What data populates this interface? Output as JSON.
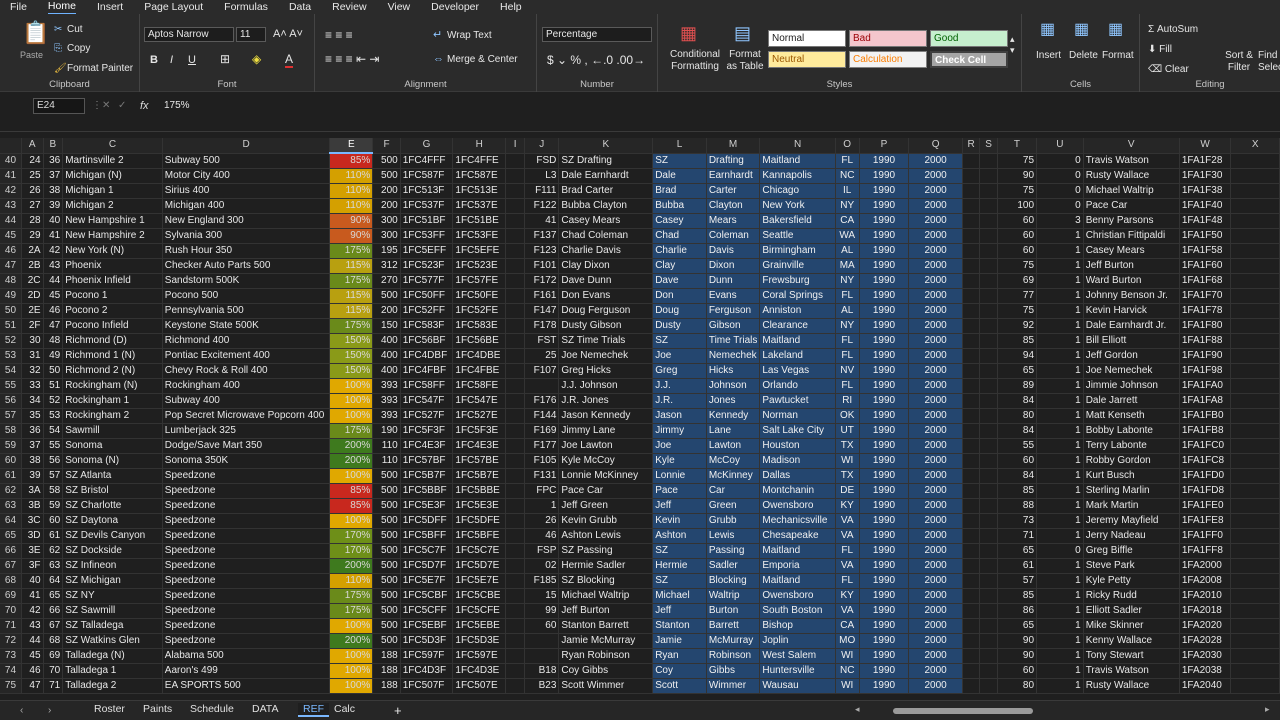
{
  "menu": [
    "File",
    "Home",
    "Insert",
    "Page Layout",
    "Formulas",
    "Data",
    "Review",
    "View",
    "Developer",
    "Help"
  ],
  "ribbon": {
    "clipboard": {
      "paste": "Paste",
      "cut": "Cut",
      "copy": "Copy",
      "painter": "Format Painter",
      "label": "Clipboard"
    },
    "font": {
      "name": "Aptos Narrow",
      "size": "11",
      "label": "Font"
    },
    "alignment": {
      "wrap": "Wrap Text",
      "merge": "Merge & Center",
      "label": "Alignment"
    },
    "number": {
      "format": "Percentage",
      "label": "Number"
    },
    "styles": {
      "cond": "Conditional Formatting",
      "table": "Format as Table",
      "normal": "Normal",
      "bad": "Bad",
      "good": "Good",
      "neutral": "Neutral",
      "calc": "Calculation",
      "check": "Check Cell",
      "label": "Styles"
    },
    "cells": {
      "insert": "Insert",
      "delete": "Delete",
      "format": "Format",
      "label": "Cells"
    },
    "editing": {
      "autosum": "AutoSum",
      "fill": "Fill",
      "clear": "Clear",
      "sort": "Sort & Filter",
      "find": "Find & Select",
      "label": "Editing"
    }
  },
  "formula": {
    "cell": "E24",
    "fx": "fx",
    "value": "175%"
  },
  "columns": [
    "A",
    "B",
    "C",
    "D",
    "E",
    "F",
    "G",
    "H",
    "I",
    "J",
    "K",
    "L",
    "M",
    "N",
    "O",
    "P",
    "Q",
    "R",
    "S",
    "T",
    "U",
    "V",
    "W",
    "X"
  ],
  "rows": [
    [
      "40",
      "24",
      "36",
      "Martinsville 2",
      "Subway 500",
      "85%",
      "500",
      "1FC4FFF",
      "1FC4FFE",
      "",
      "FSD",
      "SZ Drafting",
      "SZ",
      "Drafting",
      "Maitland",
      "FL",
      "1990",
      "2000",
      "",
      "",
      "75",
      "0",
      "Travis Watson",
      "1FA1F28",
      ""
    ],
    [
      "41",
      "25",
      "37",
      "Michigan (N)",
      "Motor City 400",
      "110%",
      "500",
      "1FC587F",
      "1FC587E",
      "",
      "L3",
      "Dale Earnhardt",
      "Dale",
      "Earnhardt",
      "Kannapolis",
      "NC",
      "1990",
      "2000",
      "",
      "",
      "90",
      "0",
      "Rusty Wallace",
      "1FA1F30",
      ""
    ],
    [
      "42",
      "26",
      "38",
      "Michigan 1",
      "Sirius 400",
      "110%",
      "200",
      "1FC513F",
      "1FC513E",
      "",
      "F111",
      "Brad Carter",
      "Brad",
      "Carter",
      "Chicago",
      "IL",
      "1990",
      "2000",
      "",
      "",
      "75",
      "0",
      "Michael Waltrip",
      "1FA1F38",
      ""
    ],
    [
      "43",
      "27",
      "39",
      "Michigan 2",
      "Michigan 400",
      "110%",
      "200",
      "1FC537F",
      "1FC537E",
      "",
      "F122",
      "Bubba Clayton",
      "Bubba",
      "Clayton",
      "New York",
      "NY",
      "1990",
      "2000",
      "",
      "",
      "100",
      "0",
      "Pace Car",
      "1FA1F40",
      ""
    ],
    [
      "44",
      "28",
      "40",
      "New Hampshire 1",
      "New England 300",
      "90%",
      "300",
      "1FC51BF",
      "1FC51BE",
      "",
      "41",
      "Casey Mears",
      "Casey",
      "Mears",
      "Bakersfield",
      "CA",
      "1990",
      "2000",
      "",
      "",
      "60",
      "3",
      "Benny Parsons",
      "1FA1F48",
      ""
    ],
    [
      "45",
      "29",
      "41",
      "New Hampshire 2",
      "Sylvania 300",
      "90%",
      "300",
      "1FC53FF",
      "1FC53FE",
      "",
      "F137",
      "Chad Coleman",
      "Chad",
      "Coleman",
      "Seattle",
      "WA",
      "1990",
      "2000",
      "",
      "",
      "60",
      "1",
      "Christian Fittipaldi",
      "1FA1F50",
      ""
    ],
    [
      "46",
      "2A",
      "42",
      "New York (N)",
      "Rush Hour 350",
      "175%",
      "195",
      "1FC5EFF",
      "1FC5EFE",
      "",
      "F123",
      "Charlie Davis",
      "Charlie",
      "Davis",
      "Birmingham",
      "AL",
      "1990",
      "2000",
      "",
      "",
      "60",
      "1",
      "Casey Mears",
      "1FA1F58",
      ""
    ],
    [
      "47",
      "2B",
      "43",
      "Phoenix",
      "Checker Auto Parts 500",
      "115%",
      "312",
      "1FC523F",
      "1FC523E",
      "",
      "F101",
      "Clay Dixon",
      "Clay",
      "Dixon",
      "Grainville",
      "MA",
      "1990",
      "2000",
      "",
      "",
      "75",
      "1",
      "Jeff Burton",
      "1FA1F60",
      ""
    ],
    [
      "48",
      "2C",
      "44",
      "Phoenix Infield",
      "Sandstorm 500K",
      "175%",
      "270",
      "1FC577F",
      "1FC57FE",
      "",
      "F172",
      "Dave Dunn",
      "Dave",
      "Dunn",
      "Frewsburg",
      "NY",
      "1990",
      "2000",
      "",
      "",
      "69",
      "1",
      "Ward Burton",
      "1FA1F68",
      ""
    ],
    [
      "49",
      "2D",
      "45",
      "Pocono 1",
      "Pocono 500",
      "115%",
      "500",
      "1FC50FF",
      "1FC50FE",
      "",
      "F161",
      "Don Evans",
      "Don",
      "Evans",
      "Coral Springs",
      "FL",
      "1990",
      "2000",
      "",
      "",
      "77",
      "1",
      "Johnny Benson Jr.",
      "1FA1F70",
      ""
    ],
    [
      "50",
      "2E",
      "46",
      "Pocono 2",
      "Pennsylvania 500",
      "115%",
      "200",
      "1FC52FF",
      "1FC52FE",
      "",
      "F147",
      "Doug Ferguson",
      "Doug",
      "Ferguson",
      "Anniston",
      "AL",
      "1990",
      "2000",
      "",
      "",
      "75",
      "1",
      "Kevin Harvick",
      "1FA1F78",
      ""
    ],
    [
      "51",
      "2F",
      "47",
      "Pocono Infield",
      "Keystone State 500K",
      "175%",
      "150",
      "1FC583F",
      "1FC583E",
      "",
      "F178",
      "Dusty Gibson",
      "Dusty",
      "Gibson",
      "Clearance",
      "NY",
      "1990",
      "2000",
      "",
      "",
      "92",
      "1",
      "Dale Earnhardt Jr.",
      "1FA1F80",
      ""
    ],
    [
      "52",
      "30",
      "48",
      "Richmond (D)",
      "Richmond 400",
      "150%",
      "400",
      "1FC56BF",
      "1FC56BE",
      "",
      "FST",
      "SZ Time Trials",
      "SZ",
      "Time Trials",
      "Maitland",
      "FL",
      "1990",
      "2000",
      "",
      "",
      "85",
      "1",
      "Bill Elliott",
      "1FA1F88",
      ""
    ],
    [
      "53",
      "31",
      "49",
      "Richmond 1 (N)",
      "Pontiac Excitement 400",
      "150%",
      "400",
      "1FC4DBF",
      "1FC4DBE",
      "",
      "25",
      "Joe Nemechek",
      "Joe",
      "Nemechek",
      "Lakeland",
      "FL",
      "1990",
      "2000",
      "",
      "",
      "94",
      "1",
      "Jeff Gordon",
      "1FA1F90",
      ""
    ],
    [
      "54",
      "32",
      "50",
      "Richmond 2 (N)",
      "Chevy Rock & Roll 400",
      "150%",
      "400",
      "1FC4FBF",
      "1FC4FBE",
      "",
      "F107",
      "Greg Hicks",
      "Greg",
      "Hicks",
      "Las Vegas",
      "NV",
      "1990",
      "2000",
      "",
      "",
      "65",
      "1",
      "Joe Nemechek",
      "1FA1F98",
      ""
    ],
    [
      "55",
      "33",
      "51",
      "Rockingham (N)",
      "Rockingham 400",
      "100%",
      "393",
      "1FC58FF",
      "1FC58FE",
      "",
      "",
      "J.J. Johnson",
      "J.J.",
      "Johnson",
      "Orlando",
      "FL",
      "1990",
      "2000",
      "",
      "",
      "89",
      "1",
      "Jimmie Johnson",
      "1FA1FA0",
      ""
    ],
    [
      "56",
      "34",
      "52",
      "Rockingham 1",
      "Subway 400",
      "100%",
      "393",
      "1FC547F",
      "1FC547E",
      "",
      "F176",
      "J.R. Jones",
      "J.R.",
      "Jones",
      "Pawtucket",
      "RI",
      "1990",
      "2000",
      "",
      "",
      "84",
      "1",
      "Dale Jarrett",
      "1FA1FA8",
      ""
    ],
    [
      "57",
      "35",
      "53",
      "Rockingham 2",
      "Pop Secret Microwave Popcorn 400",
      "100%",
      "393",
      "1FC527F",
      "1FC527E",
      "",
      "F144",
      "Jason Kennedy",
      "Jason",
      "Kennedy",
      "Norman",
      "OK",
      "1990",
      "2000",
      "",
      "",
      "80",
      "1",
      "Matt Kenseth",
      "1FA1FB0",
      ""
    ],
    [
      "58",
      "36",
      "54",
      "Sawmill",
      "Lumberjack 325",
      "175%",
      "190",
      "1FC5F3F",
      "1FC5F3E",
      "",
      "F169",
      "Jimmy Lane",
      "Jimmy",
      "Lane",
      "Salt Lake City",
      "UT",
      "1990",
      "2000",
      "",
      "",
      "84",
      "1",
      "Bobby Labonte",
      "1FA1FB8",
      ""
    ],
    [
      "59",
      "37",
      "55",
      "Sonoma",
      "Dodge/Save Mart 350",
      "200%",
      "110",
      "1FC4E3F",
      "1FC4E3E",
      "",
      "F177",
      "Joe Lawton",
      "Joe",
      "Lawton",
      "Houston",
      "TX",
      "1990",
      "2000",
      "",
      "",
      "55",
      "1",
      "Terry Labonte",
      "1FA1FC0",
      ""
    ],
    [
      "60",
      "38",
      "56",
      "Sonoma (N)",
      "Sonoma 350K",
      "200%",
      "110",
      "1FC57BF",
      "1FC57BE",
      "",
      "F105",
      "Kyle McCoy",
      "Kyle",
      "McCoy",
      "Madison",
      "WI",
      "1990",
      "2000",
      "",
      "",
      "60",
      "1",
      "Robby Gordon",
      "1FA1FC8",
      ""
    ],
    [
      "61",
      "39",
      "57",
      "SZ Atlanta",
      "Speedzone",
      "100%",
      "500",
      "1FC5B7F",
      "1FC5B7E",
      "",
      "F131",
      "Lonnie McKinney",
      "Lonnie",
      "McKinney",
      "Dallas",
      "TX",
      "1990",
      "2000",
      "",
      "",
      "84",
      "1",
      "Kurt Busch",
      "1FA1FD0",
      ""
    ],
    [
      "62",
      "3A",
      "58",
      "SZ Bristol",
      "Speedzone",
      "85%",
      "500",
      "1FC5BBF",
      "1FC5BBE",
      "",
      "FPC",
      "Pace Car",
      "Pace",
      "Car",
      "Montchanin",
      "DE",
      "1990",
      "2000",
      "",
      "",
      "85",
      "1",
      "Sterling Marlin",
      "1FA1FD8",
      ""
    ],
    [
      "63",
      "3B",
      "59",
      "SZ Charlotte",
      "Speedzone",
      "85%",
      "500",
      "1FC5E3F",
      "1FC5E3E",
      "",
      "1",
      "Jeff Green",
      "Jeff",
      "Green",
      "Owensboro",
      "KY",
      "1990",
      "2000",
      "",
      "",
      "88",
      "1",
      "Mark Martin",
      "1FA1FE0",
      ""
    ],
    [
      "64",
      "3C",
      "60",
      "SZ Daytona",
      "Speedzone",
      "100%",
      "500",
      "1FC5DFF",
      "1FC5DFE",
      "",
      "26",
      "Kevin Grubb",
      "Kevin",
      "Grubb",
      "Mechanicsville",
      "VA",
      "1990",
      "2000",
      "",
      "",
      "73",
      "1",
      "Jeremy Mayfield",
      "1FA1FE8",
      ""
    ],
    [
      "65",
      "3D",
      "61",
      "SZ Devils Canyon",
      "Speedzone",
      "170%",
      "500",
      "1FC5BFF",
      "1FC5BFE",
      "",
      "46",
      "Ashton Lewis",
      "Ashton",
      "Lewis",
      "Chesapeake",
      "VA",
      "1990",
      "2000",
      "",
      "",
      "71",
      "1",
      "Jerry Nadeau",
      "1FA1FF0",
      ""
    ],
    [
      "66",
      "3E",
      "62",
      "SZ Dockside",
      "Speedzone",
      "170%",
      "500",
      "1FC5C7F",
      "1FC5C7E",
      "",
      "FSP",
      "SZ Passing",
      "SZ",
      "Passing",
      "Maitland",
      "FL",
      "1990",
      "2000",
      "",
      "",
      "65",
      "0",
      "Greg Biffle",
      "1FA1FF8",
      ""
    ],
    [
      "67",
      "3F",
      "63",
      "SZ Infineon",
      "Speedzone",
      "200%",
      "500",
      "1FC5D7F",
      "1FC5D7E",
      "",
      "02",
      "Hermie Sadler",
      "Hermie",
      "Sadler",
      "Emporia",
      "VA",
      "1990",
      "2000",
      "",
      "",
      "61",
      "1",
      "Steve Park",
      "1FA2000",
      ""
    ],
    [
      "68",
      "40",
      "64",
      "SZ Michigan",
      "Speedzone",
      "110%",
      "500",
      "1FC5E7F",
      "1FC5E7E",
      "",
      "F185",
      "SZ Blocking",
      "SZ",
      "Blocking",
      "Maitland",
      "FL",
      "1990",
      "2000",
      "",
      "",
      "57",
      "1",
      "Kyle Petty",
      "1FA2008",
      ""
    ],
    [
      "69",
      "41",
      "65",
      "SZ NY",
      "Speedzone",
      "175%",
      "500",
      "1FC5CBF",
      "1FC5CBE",
      "",
      "15",
      "Michael Waltrip",
      "Michael",
      "Waltrip",
      "Owensboro",
      "KY",
      "1990",
      "2000",
      "",
      "",
      "85",
      "1",
      "Ricky Rudd",
      "1FA2010",
      ""
    ],
    [
      "70",
      "42",
      "66",
      "SZ Sawmill",
      "Speedzone",
      "175%",
      "500",
      "1FC5CFF",
      "1FC5CFE",
      "",
      "99",
      "Jeff Burton",
      "Jeff",
      "Burton",
      "South Boston",
      "VA",
      "1990",
      "2000",
      "",
      "",
      "86",
      "1",
      "Elliott Sadler",
      "1FA2018",
      ""
    ],
    [
      "71",
      "43",
      "67",
      "SZ Talladega",
      "Speedzone",
      "100%",
      "500",
      "1FC5EBF",
      "1FC5EBE",
      "",
      "60",
      "Stanton Barrett",
      "Stanton",
      "Barrett",
      "Bishop",
      "CA",
      "1990",
      "2000",
      "",
      "",
      "65",
      "1",
      "Mike Skinner",
      "1FA2020",
      ""
    ],
    [
      "72",
      "44",
      "68",
      "SZ Watkins Glen",
      "Speedzone",
      "200%",
      "500",
      "1FC5D3F",
      "1FC5D3E",
      "",
      "",
      "Jamie McMurray",
      "Jamie",
      "McMurray",
      "Joplin",
      "MO",
      "1990",
      "2000",
      "",
      "",
      "90",
      "1",
      "Kenny Wallace",
      "1FA2028",
      ""
    ],
    [
      "73",
      "45",
      "69",
      "Talladega (N)",
      "Alabama 500",
      "100%",
      "188",
      "1FC597F",
      "1FC597E",
      "",
      "",
      "Ryan Robinson",
      "Ryan",
      "Robinson",
      "West Salem",
      "WI",
      "1990",
      "2000",
      "",
      "",
      "90",
      "1",
      "Tony Stewart",
      "1FA2030",
      ""
    ],
    [
      "74",
      "46",
      "70",
      "Talladega 1",
      "Aaron's 499",
      "100%",
      "188",
      "1FC4D3F",
      "1FC4D3E",
      "",
      "B18",
      "Coy Gibbs",
      "Coy",
      "Gibbs",
      "Huntersville",
      "NC",
      "1990",
      "2000",
      "",
      "",
      "60",
      "1",
      "Travis Watson",
      "1FA2038",
      ""
    ],
    [
      "75",
      "47",
      "71",
      "Talladega 2",
      "EA SPORTS 500",
      "100%",
      "188",
      "1FC507F",
      "1FC507E",
      "",
      "B23",
      "Scott Wimmer",
      "Scott",
      "Wimmer",
      "Wausau",
      "WI",
      "1990",
      "2000",
      "",
      "",
      "80",
      "1",
      "Rusty Wallace",
      "1FA2040",
      ""
    ]
  ],
  "pct_colors": {
    "85%": "#c8281e",
    "90%": "#c85a1e",
    "100%": "#e0a800",
    "110%": "#d4a000",
    "115%": "#b8a010",
    "150%": "#8a9a18",
    "170%": "#6e8f18",
    "175%": "#6a8a1a",
    "200%": "#3e7a1e"
  },
  "sheets": [
    "Roster",
    "Paints",
    "Schedule",
    "DATA",
    "REF",
    "Calc"
  ],
  "active_sheet": "REF"
}
